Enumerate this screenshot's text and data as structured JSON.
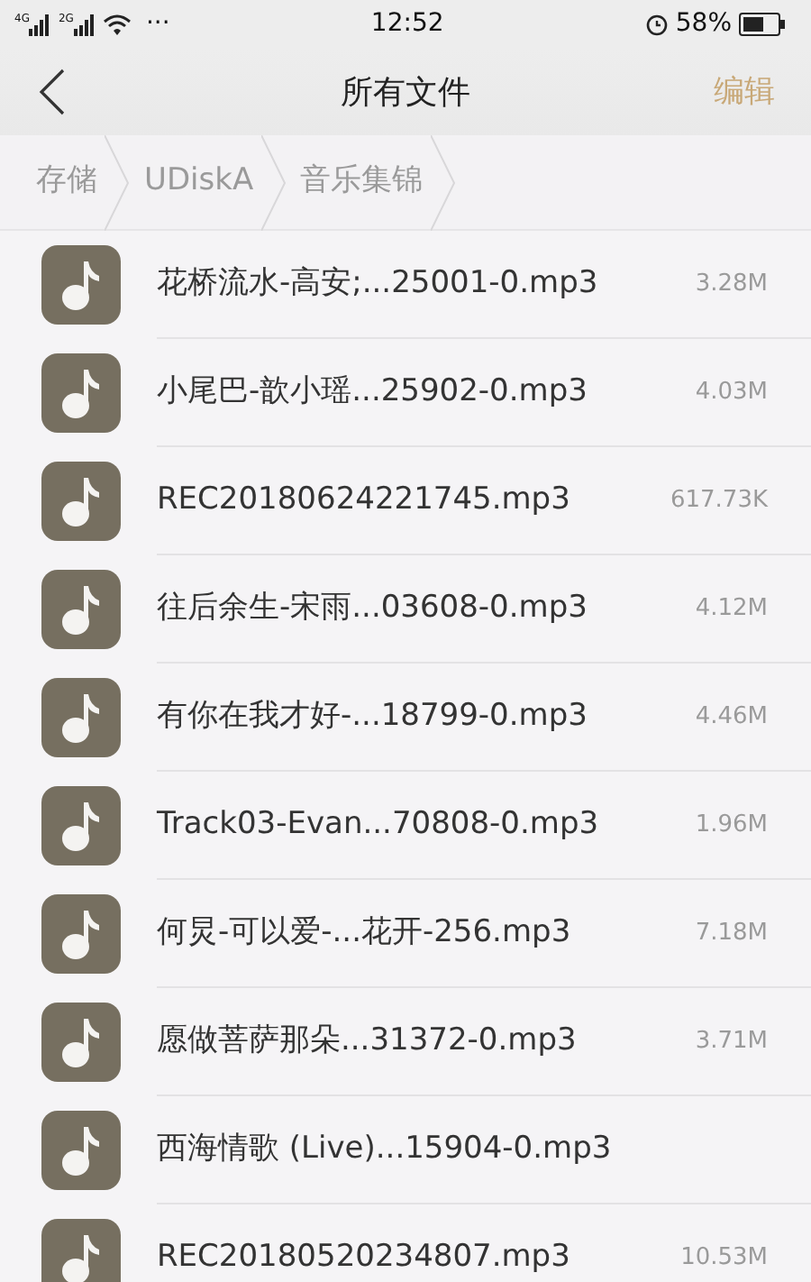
{
  "status_bar": {
    "time": "12:52",
    "network_labels": [
      "4G",
      "2G"
    ],
    "more": "···",
    "battery": "58%"
  },
  "header": {
    "title": "所有文件",
    "action": "编辑"
  },
  "breadcrumbs": [
    "存储",
    "UDiskA",
    "音乐集锦"
  ],
  "files": [
    {
      "name": "花桥流水-高安;...25001-0.mp3",
      "size": "3.28M"
    },
    {
      "name": "小尾巴-歆小瑶...25902-0.mp3",
      "size": "4.03M"
    },
    {
      "name": "REC20180624221745.mp3",
      "size": "617.73K"
    },
    {
      "name": "往后余生-宋雨...03608-0.mp3",
      "size": "4.12M"
    },
    {
      "name": "有你在我才好-...18799-0.mp3",
      "size": "4.46M"
    },
    {
      "name": "Track03-Evan...70808-0.mp3",
      "size": "1.96M"
    },
    {
      "name": "何炅-可以爱-...花开-256.mp3",
      "size": "7.18M"
    },
    {
      "name": "愿做菩萨那朵...31372-0.mp3",
      "size": "3.71M"
    },
    {
      "name": "西海情歌 (Live)...15904-0.mp3"
    },
    {
      "name": "REC20180520234807.mp3",
      "size": "10.53M"
    }
  ]
}
